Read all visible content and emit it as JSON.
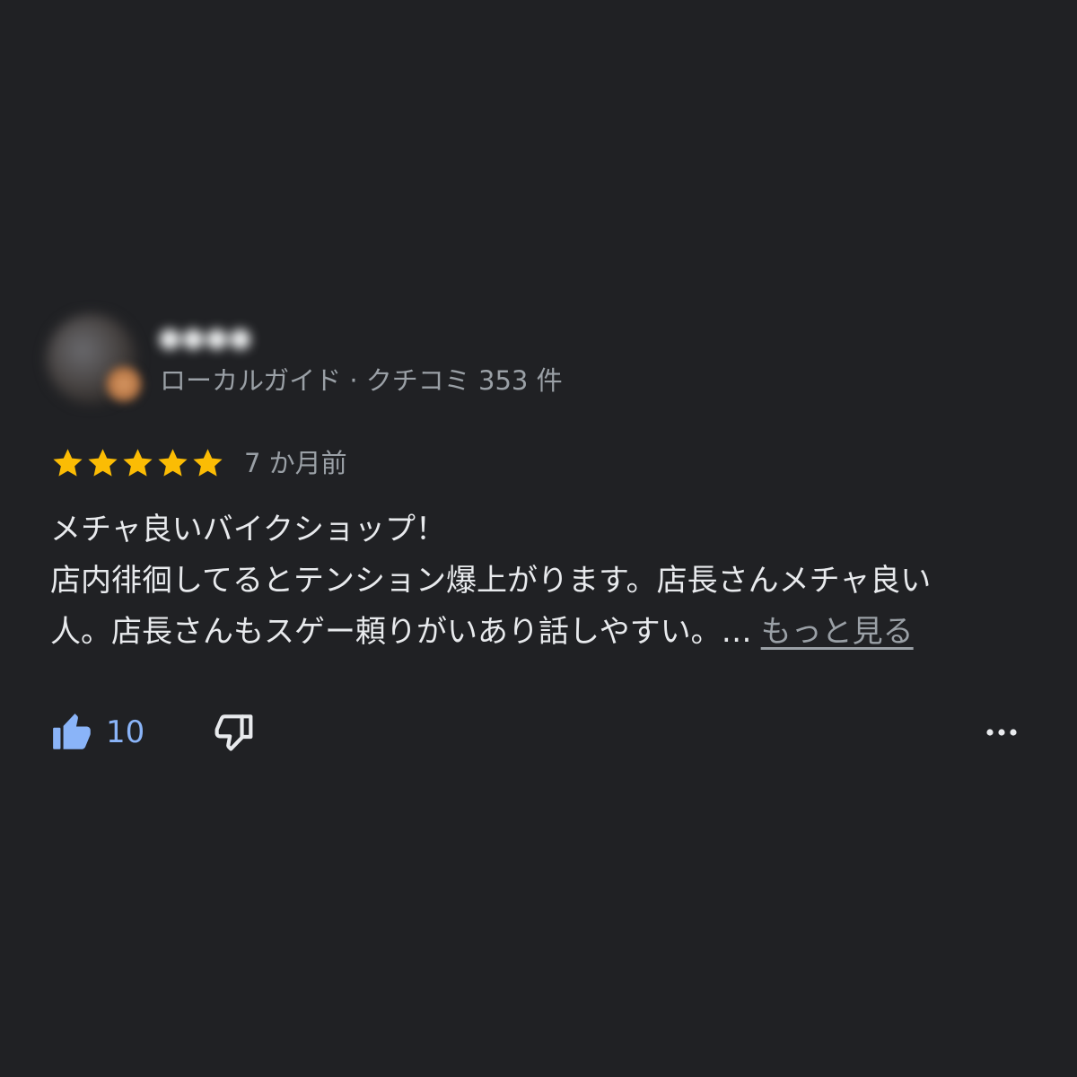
{
  "review": {
    "author_name": "●●●●",
    "author_meta": "ローカルガイド · クチコミ 353 件",
    "rating": 5,
    "rating_max": 5,
    "time_ago": "7 か月前",
    "text_lines": [
      "メチャ良いバイクショップ！",
      "店内徘徊してるとテンション爆上がります。店長さんメチャ良い",
      "人。店長さんもスゲー頼りがいあり話しやすい。…"
    ],
    "more_label": "もっと見る",
    "like_count": "10",
    "icons": {
      "star": "star-icon",
      "like": "thumbs-up-icon",
      "dislike": "thumbs-down-icon",
      "more": "more-horizontal-icon"
    },
    "colors": {
      "background": "#202124",
      "star": "#fbbc04",
      "accent": "#8ab4f8",
      "secondary_text": "#9aa0a6",
      "primary_text": "#e8eaed"
    }
  }
}
